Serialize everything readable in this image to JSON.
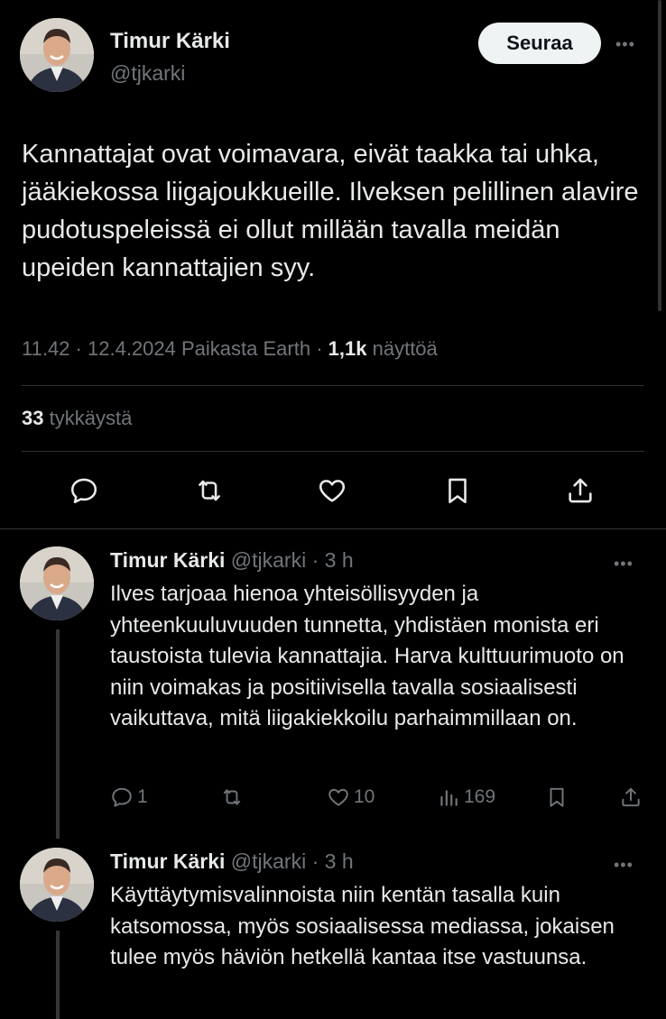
{
  "main_tweet": {
    "author_name": "Timur Kärki",
    "author_handle": "@tjkarki",
    "follow_label": "Seuraa",
    "text": "Kannattajat ovat voimavara, eivät taakka tai uhka, jääkiekossa liigajoukkueille. Ilveksen pelillinen alavire pudotuspeleissä ei ollut millään tavalla meidän upeiden kannattajien syy.",
    "time": "11.42",
    "sep": "·",
    "date": "12.4.2024",
    "location": "Paikasta Earth",
    "views_count": "1,1k",
    "views_label": "näyttöä",
    "likes_count": "33",
    "likes_label": "tykkäystä"
  },
  "replies": [
    {
      "author_name": "Timur Kärki",
      "author_handle": "@tjkarki",
      "time_ago": "· 3 h",
      "text": "Ilves tarjoaa hienoa yhteisöllisyyden ja yhteenkuuluvuuden tunnetta, yhdistäen monista eri taustoista tulevia kannattajia. Harva kulttuurimuoto on niin voimakas ja positiivisella tavalla sosiaalisesti vaikuttava, mitä liigakiekkoilu parhaimmillaan on.",
      "replies_count": "1",
      "retweets_count": "",
      "likes_count": "10",
      "views_count": "169"
    },
    {
      "author_name": "Timur Kärki",
      "author_handle": "@tjkarki",
      "time_ago": "· 3 h",
      "text": "Käyttäytymisvalinnoista niin kentän tasalla kuin katsomossa, myös sosiaalisessa mediassa, jokaisen tulee myös häviön hetkellä kantaa itse vastuunsa."
    }
  ],
  "icons": {
    "reply": "speech-bubble-icon",
    "retweet": "retweet-icon",
    "like": "heart-icon",
    "bookmark": "bookmark-icon",
    "share": "share-icon",
    "views": "bar-chart-icon",
    "more": "more-dots-icon"
  },
  "colors": {
    "background": "#000000",
    "text_primary": "#e7e9ea",
    "text_secondary": "#71767b",
    "divider": "#2f3336",
    "follow_bg": "#eff3f4"
  }
}
